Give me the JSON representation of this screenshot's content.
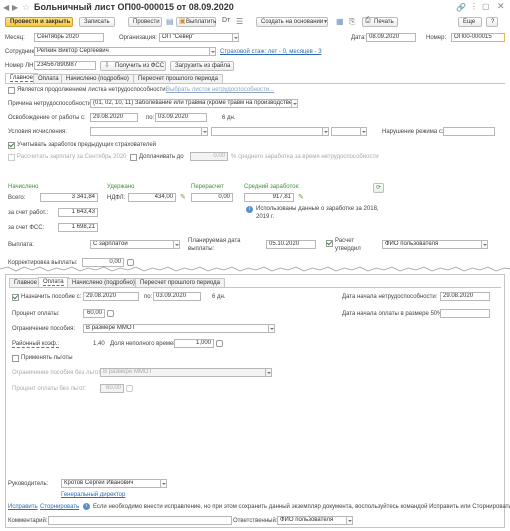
{
  "title": "Больничный лист ОП00-000015 от 08.09.2020",
  "toolbar": {
    "post_close": "Провести и закрыть",
    "save": "Записать",
    "post": "Провести",
    "pay": "Выплатить",
    "create_based": "Создать на основании",
    "print": "Печать",
    "more": "Еще",
    "help": "?"
  },
  "header": {
    "month_label": "Месяц:",
    "month": "Сентябрь 2020",
    "org_label": "Организация:",
    "org": "ОП \"Север\"",
    "date_label": "Дата:",
    "date": "08.09.2020",
    "num_label": "Номер:",
    "num": "ОП00-000015",
    "emp_label": "Сотрудник:",
    "emp": "Репкин Виктор Сергеевич",
    "stazh": "Страховой стаж: лет - 0, месяцев - 3",
    "sick_label": "Номер ЛН:",
    "sick": "234567890987",
    "fss_btn": "Получить из ФСС",
    "load_btn": "Загрузить из файла"
  },
  "tabs_top": [
    "Главное",
    "Оплата",
    "Начислено (подробно)",
    "Пересчет прошлого периода"
  ],
  "main": {
    "cont_chk": "Является продолжением листка нетрудоспособности:",
    "cont_link": "Выбрать листок нетрудоспособности...",
    "reason_label": "Причина нетрудоспособности:",
    "reason": "(01, 02, 10, 11) Заболевание или травма (кроме травм на производстве)",
    "release_label": "Освобождение от работы с:",
    "release_from": "29.08.2020",
    "po": "по:",
    "release_to": "03.09.2020",
    "days": "6 дн.",
    "cond_label": "Условия исчисления:",
    "regime_label": "Нарушение режима с:",
    "prev_chk": "Учитывать заработок предыдущих страхователей",
    "recalc_chk": "Рассчитать зарплату за Сентябрь 2020",
    "pay_to_chk": "Доплачивать до",
    "pay_to_val": "0,00",
    "pay_to_text": "% среднего заработка за время нетрудоспособности",
    "accr_label": "Начислено",
    "withheld_label": "Удержано",
    "recalc_label": "Перерасчет",
    "avg_label": "Средний заработок:",
    "total_label": "Всего:",
    "total": "3 341,84",
    "ndfl_label": "НДФЛ:",
    "ndfl": "434,00",
    "recalc": "0,00",
    "avg": "917,81",
    "emp_acc_label": "за счет работ.:",
    "emp_acc": "1 643,43",
    "fss_acc_label": "за счет ФСС:",
    "fss_acc": "1 698,21",
    "years_text": "Использованы данные о заработке за 2018, 2019 г.",
    "payout_label": "Выплата:",
    "payout": "С зарплатой",
    "plan_label": "Планируемая дата выплаты:",
    "plan": "05.10.2020",
    "approved_chk": "Расчет утвердил",
    "approver": "ФИО пользователя",
    "corr_label": "Корректировка выплаты:",
    "corr": "0,00"
  },
  "tabs_bottom": [
    "Главное",
    "Оплата",
    "Начислено (подробно)",
    "Пересчет прошлого периода"
  ],
  "pay": {
    "assign_chk": "Назначить пособие с:",
    "assign_from": "29.08.2020",
    "po": "по:",
    "assign_to": "03.09.2020",
    "days": "6 дн.",
    "start_label": "Дата начала нетрудоспособности:",
    "start": "29.08.2020",
    "percent_label": "Процент оплаты:",
    "percent": "60,00",
    "start50_label": "Дата начала оплаты в размере 50%:",
    "limit_label": "Ограничение пособия:",
    "limit": "В размере ММОТ",
    "coef_label": "Районный коэф.:",
    "coef": "1,40",
    "part_label": "Доля неполного времени:",
    "part": "1,000",
    "benefit_chk": "Применять льготы",
    "limit2_label": "Ограничение пособия без льгот:",
    "limit2": "В размере ММОТ",
    "percent2_label": "Процент оплаты без льгот:",
    "percent2": "60,00"
  },
  "footer": {
    "head_label": "Руководитель:",
    "head": "Кротов Сергей Иванович",
    "head_pos": "Генеральный директор",
    "fix_link": "Исправить",
    "storno_link": "Сторнировать",
    "info": "Если необходимо внести исправление, но при этом сохранить данный экземпляр документа, воспользуйтесь командой Исправить или Сторнировать",
    "comment_label": "Комментарий:",
    "resp_label": "Ответственный:",
    "resp": "ФИО пользователя"
  }
}
